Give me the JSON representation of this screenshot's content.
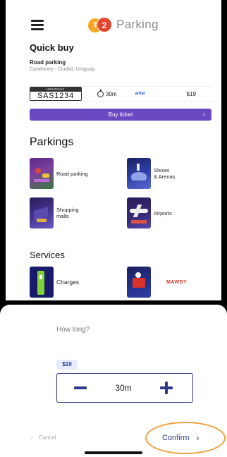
{
  "app": {
    "logo_left": "T",
    "logo_right": "2",
    "title": "Parking"
  },
  "quick_buy": {
    "title": "Quick buy",
    "label": "Road parking",
    "location": "Canelones - Ciudad, Uruguay",
    "plate_country": "URUGUAY",
    "plate_number": "SAS1234",
    "duration": "30m",
    "carrier": "antel",
    "price": "$19",
    "buy_label": "Buy ticket"
  },
  "parkings": {
    "title": "Parkings",
    "items": [
      {
        "label": "Road parking"
      },
      {
        "label": "Shows\n& Arenas"
      },
      {
        "label": "Shopping\nmalls"
      },
      {
        "label": "Airports"
      }
    ]
  },
  "services": {
    "title": "Services",
    "items": [
      {
        "label": "Charges"
      },
      {
        "label": "MAWDY"
      }
    ]
  },
  "sheet": {
    "title": "How long?",
    "price": "$19",
    "duration_value": "30m",
    "cancel_label": "Cancel",
    "confirm_label": "Confirm"
  },
  "colors": {
    "primary": "#6a48c2",
    "accent_dark": "#2d3a8c",
    "highlight": "#f0a03c"
  }
}
